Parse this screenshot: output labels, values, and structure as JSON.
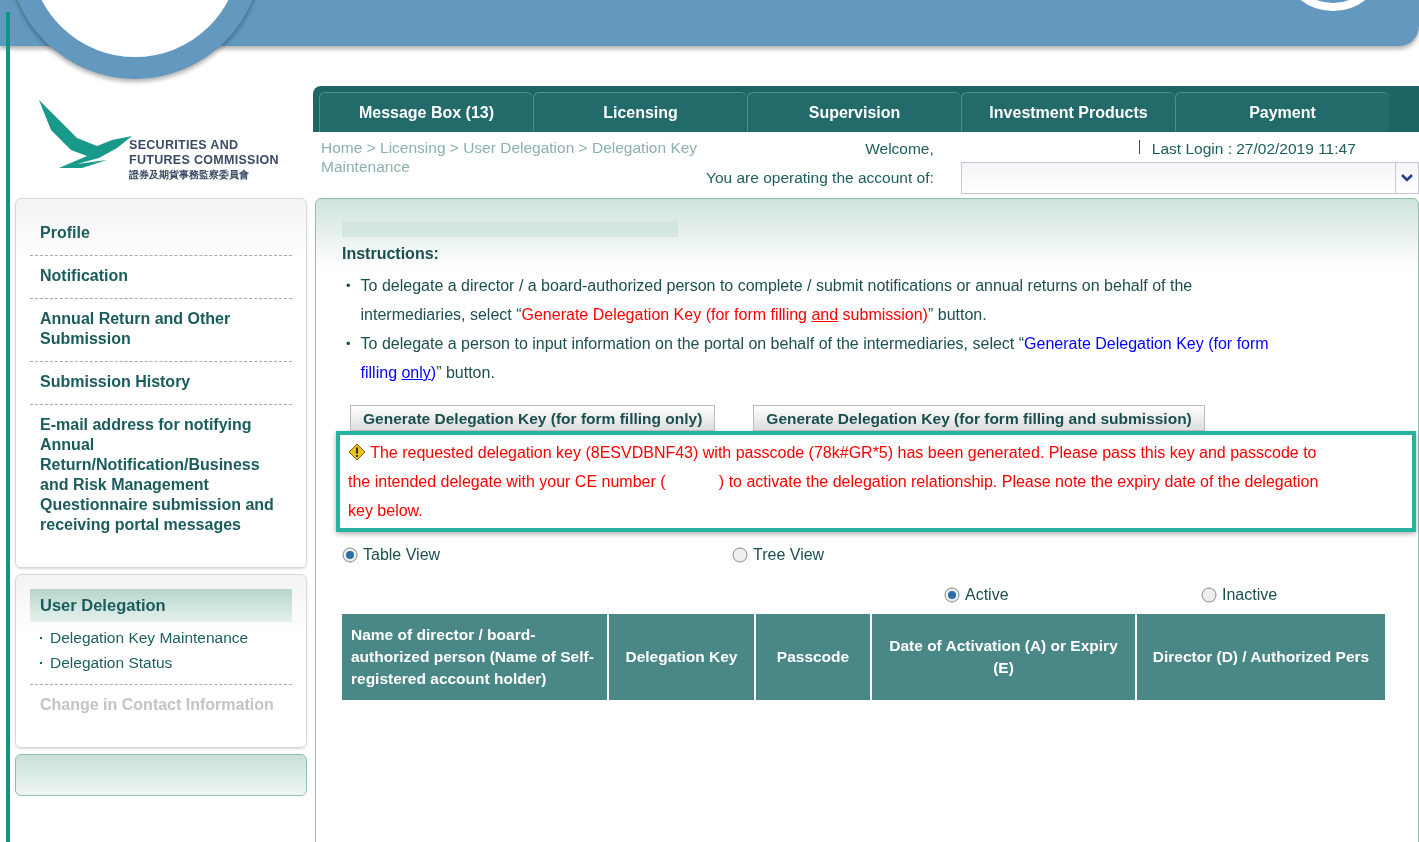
{
  "logo": {
    "lines": [
      "SECURITIES AND",
      "FUTURES COMMISSION"
    ],
    "chinese": "證券及期貨事務監察委員會"
  },
  "nav_tabs": [
    {
      "label": "Message Box (13)"
    },
    {
      "label": "Licensing"
    },
    {
      "label": "Supervision"
    },
    {
      "label": "Investment Products"
    },
    {
      "label": "Payment"
    }
  ],
  "breadcrumb": "Home > Licensing > User Delegation > Delegation Key Maintenance",
  "welcome": "Welcome,",
  "last_login": "Last Login : 27/02/2019 11:47",
  "account_label": "You are operating the account of:",
  "sidebar": {
    "items": [
      {
        "label": "Profile",
        "disabled": false
      },
      {
        "label": "Notification",
        "disabled": false
      },
      {
        "label": "Annual Return and Other Submission",
        "disabled": false
      },
      {
        "label": "Submission History",
        "disabled": false
      },
      {
        "label": "E-mail address for notifying Annual Return/Notification/Business and Risk Management Questionnaire submission and receiving portal messages",
        "disabled": false
      }
    ],
    "section": {
      "title": "User Delegation",
      "children": [
        {
          "label": "Delegation Key Maintenance"
        },
        {
          "label": "Delegation Status"
        }
      ],
      "items": [
        {
          "label": "Change in Contact Information",
          "disabled": true
        }
      ]
    }
  },
  "instructions": {
    "title": "Instructions:",
    "marker": "•",
    "bullets": [
      [
        {
          "kind": "plain",
          "text": "To delegate a director / a board-authorized person to complete / submit notifications or annual returns on behalf of the intermediaries, select “"
        },
        {
          "kind": "red",
          "text": "Generate Delegation Key (for form filling "
        },
        {
          "kind": "red-link",
          "text": "and"
        },
        {
          "kind": "red",
          "text": " submission)"
        },
        {
          "kind": "plain",
          "text": "” button."
        }
      ],
      [
        {
          "kind": "plain",
          "text": "To delegate a person to input information on the portal on behalf of the intermediaries, select “"
        },
        {
          "kind": "blue",
          "text": "Generate Delegation Key (for form filling "
        },
        {
          "kind": "blue-link",
          "text": "only"
        },
        {
          "kind": "blue",
          "text": ")"
        },
        {
          "kind": "plain",
          "text": "” button."
        }
      ]
    ]
  },
  "buttons": [
    "Generate Delegation Key (for form filling only)",
    "Generate Delegation Key (for form filling and submission)"
  ],
  "message": "The requested delegation key (8ESVDBNF43) with passcode (78k#GR*5) has been generated. Please pass this key and passcode to the intended delegate with your CE number (            ) to activate the delegation relationship. Please note the expiry date of the delegation key below.",
  "view_options": [
    {
      "label": "Table View",
      "selected": true
    },
    {
      "label": "Tree View",
      "selected": false
    }
  ],
  "status_options": [
    {
      "label": "Active",
      "selected": true
    },
    {
      "label": "Inactive",
      "selected": false
    }
  ],
  "table": {
    "columns": [
      "Name of director / board-authorized person (Name of Self-registered account holder)",
      "Delegation Key",
      "Passcode",
      "Date of Activation (A) or Expiry (E)",
      "Director (D) / Authorized Pers"
    ]
  }
}
